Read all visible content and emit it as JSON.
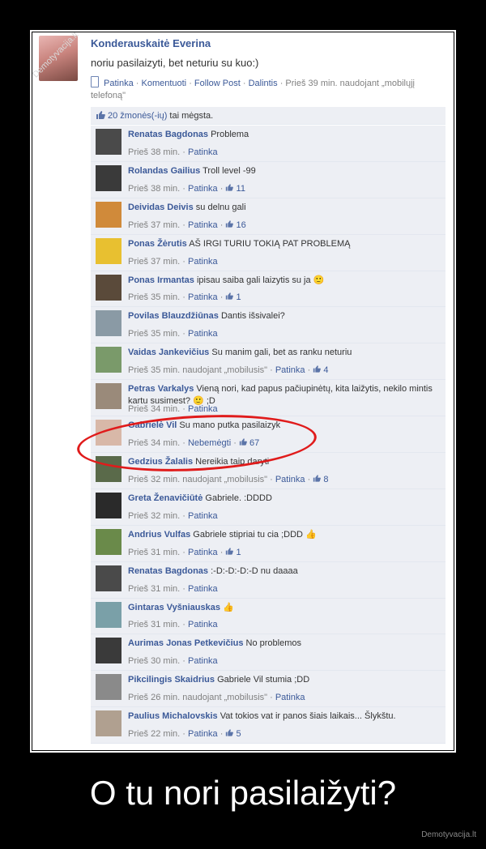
{
  "post": {
    "author": "Konderauskaitė Everina",
    "text": "noriu pasilaizyti, bet neturiu su kuo:)",
    "actions": [
      "Patinka",
      "Komentuoti",
      "Follow Post",
      "Dalintis"
    ],
    "time_line1": "Prieš 39 min. naudojant „mobilųjį",
    "time_line2": "telefoną\"",
    "watermark": "Demotyvacija.lt"
  },
  "likes": {
    "count_label": "20 žmonės(-ių)",
    "suffix": " tai mėgsta."
  },
  "comments": [
    {
      "name": "Renatas Bagdonas",
      "text": "Problema",
      "time": "Prieš 38 min.",
      "action": "Patinka",
      "likes": "",
      "mobile": "",
      "avatar": "#4a4a4a"
    },
    {
      "name": "Rolandas Gailius",
      "text": "Troll level -99",
      "time": "Prieš 38 min.",
      "action": "Patinka",
      "likes": "11",
      "mobile": "",
      "avatar": "#3a3a3a"
    },
    {
      "name": "Deividas Deivis",
      "text": "su delnu gali",
      "time": "Prieš 37 min.",
      "action": "Patinka",
      "likes": "16",
      "mobile": "",
      "avatar": "#d08a3a"
    },
    {
      "name": "Ponas Žėrutis",
      "text": "AŠ IRGI TURIU TOKIĄ PAT PROBLEMĄ",
      "time": "Prieš 37 min.",
      "action": "Patinka",
      "likes": "",
      "mobile": "",
      "avatar": "#e8c030"
    },
    {
      "name": "Ponas Irmantas",
      "text": "ipisau saiba gali laizytis su ja 🙂",
      "time": "Prieš 35 min.",
      "action": "Patinka",
      "likes": "1",
      "mobile": "",
      "avatar": "#5a4a3a"
    },
    {
      "name": "Povilas Blauzdžiūnas",
      "text": "Dantis išsivalei?",
      "time": "Prieš 35 min.",
      "action": "Patinka",
      "likes": "",
      "mobile": "",
      "avatar": "#8a9aa5"
    },
    {
      "name": "Vaidas Jankevičius",
      "text": "Su manim gali, bet as ranku neturiu",
      "time": "Prieš 35 min. naudojant „mobilusis\"",
      "action": "Patinka",
      "likes": "4",
      "mobile": "",
      "avatar": "#7a9a6a"
    },
    {
      "name": "Petras Varkalys",
      "text": "Vieną nori, kad papus pačiupinėtų, kita laižytis, nekilo mintis kartu susimest? 🙂 ;D",
      "time": "Prieš 34 min.",
      "action": "Patinka",
      "likes": "",
      "mobile": "",
      "avatar": "#9a8a7a",
      "two": true
    },
    {
      "name": "Gabrielė Vil",
      "text": "Su mano putka pasilaizyk",
      "time": "Prieš 34 min.",
      "action": "Nebemėgti",
      "likes": "67",
      "mobile": "",
      "avatar": "#d8b8a8"
    },
    {
      "name": "Gedzius Žalalis",
      "text": "Nereikia taip daryti",
      "time": "Prieš 32 min. naudojant „mobilusis\"",
      "action": "Patinka",
      "likes": "8",
      "mobile": "",
      "avatar": "#5a6a4a"
    },
    {
      "name": "Greta Ženavičiūtė",
      "text": "Gabriele. :DDDD",
      "time": "Prieš 32 min.",
      "action": "Patinka",
      "likes": "",
      "mobile": "",
      "avatar": "#2a2a2a"
    },
    {
      "name": "Andrius Vulfas",
      "text": "Gabriele stipriai tu cia ;DDD 👍",
      "time": "Prieš 31 min.",
      "action": "Patinka",
      "likes": "1",
      "mobile": "",
      "avatar": "#6a8a4a"
    },
    {
      "name": "Renatas Bagdonas",
      "text": ":-D:-D:-D:-D nu daaaa",
      "time": "Prieš 31 min.",
      "action": "Patinka",
      "likes": "",
      "mobile": "",
      "avatar": "#4a4a4a"
    },
    {
      "name": "Gintaras Vyšniauskas",
      "text": "👍",
      "time": "Prieš 31 min.",
      "action": "Patinka",
      "likes": "",
      "mobile": "",
      "avatar": "#7aa0a8"
    },
    {
      "name": "Aurimas Jonas Petkevičius",
      "text": "No problemos",
      "time": "Prieš 30 min.",
      "action": "Patinka",
      "likes": "",
      "mobile": "",
      "avatar": "#3a3a3a"
    },
    {
      "name": "Pikcilingis Skaidrius",
      "text": "Gabriele Vil stumia ;DD",
      "time": "Prieš 26 min. naudojant „mobilusis\"",
      "action": "Patinka",
      "likes": "",
      "mobile": "",
      "avatar": "#8a8a8a"
    },
    {
      "name": "Paulius Michalovskis",
      "text": "Vat tokios vat ir panos šiais laikais... Šlykštu.",
      "time": "Prieš 22 min.",
      "action": "Patinka",
      "likes": "5",
      "mobile": "",
      "avatar": "#b0a090"
    }
  ],
  "caption": "O tu nori pasilaižyti?",
  "site": "Demotyvacija.lt"
}
